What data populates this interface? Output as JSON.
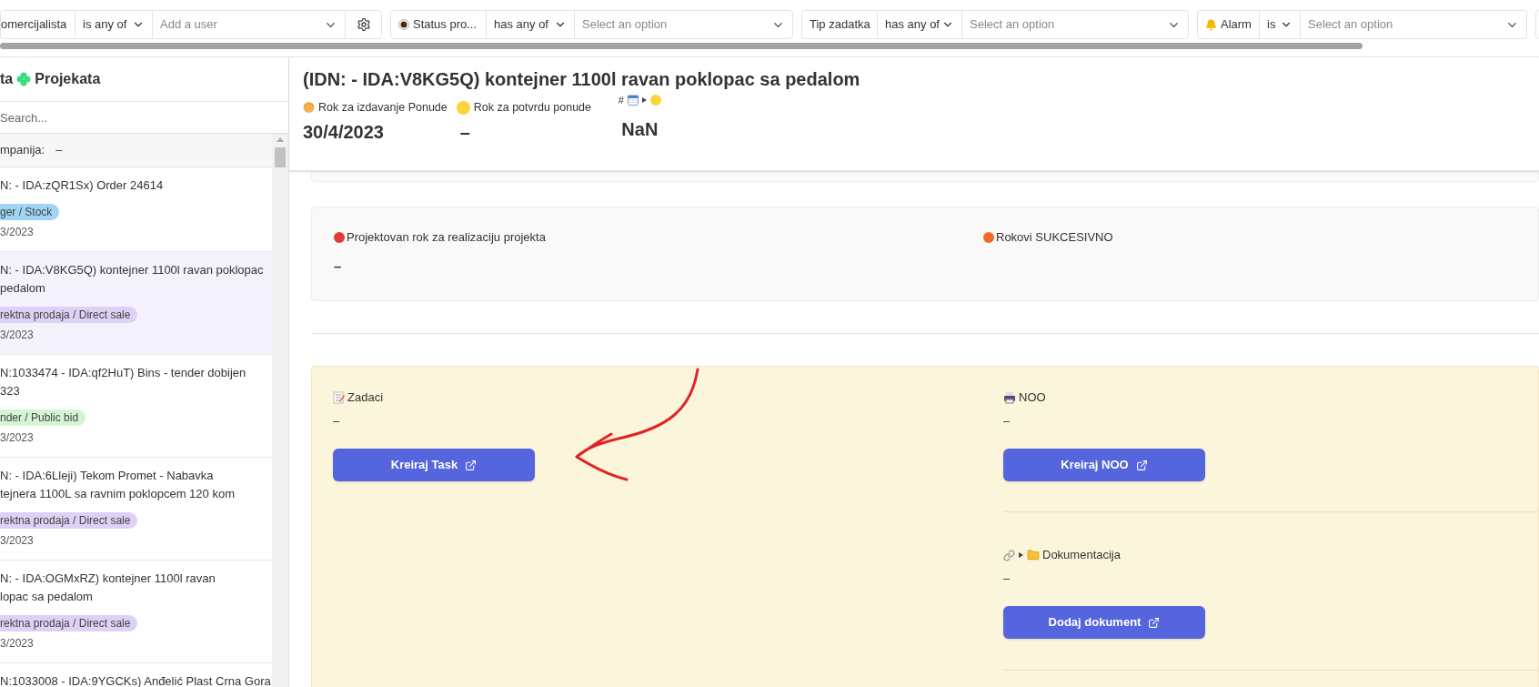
{
  "filters": [
    {
      "label": "omercijalista",
      "operator": "is any of",
      "placeholder": "Add a user",
      "settings": true
    },
    {
      "label": "Status pro...",
      "operator": "has any of",
      "placeholder": "Select an option",
      "settings": false
    },
    {
      "label": "Tip zadatka",
      "operator": "has any of",
      "placeholder": "Select an option",
      "settings": false
    },
    {
      "label": "Alarm",
      "operator": "is",
      "placeholder": "Select an option",
      "settings": false
    }
  ],
  "sidebar": {
    "title_start": "ta",
    "title": "Projekata",
    "search": {
      "placeholder": "Search..."
    },
    "group": {
      "label": "mpanija:",
      "value": "–"
    },
    "items": [
      {
        "lines": [
          "N: - IDA:zQR1Sx) Order 24614"
        ],
        "tag": "ger / Stock",
        "color": "#9fd4f5",
        "date": "3/2023",
        "selected": false
      },
      {
        "lines": [
          "N: - IDA:V8KG5Q) kontejner 1100l ravan poklopac",
          "pedalom"
        ],
        "tag": "rektna prodaja / Direct sale",
        "color": "#ddd2f6",
        "date": "3/2023",
        "selected": true
      },
      {
        "lines": [
          "N:1033474 - IDA:qf2HuT) Bins - tender dobijen",
          "323"
        ],
        "tag": "nder / Public bid",
        "color": "#d4f5d4",
        "date": "3/2023",
        "selected": false
      },
      {
        "lines": [
          "N: - IDA:6Lleji) Tekom Promet - Nabavka",
          "tejnera 1100L sa ravnim poklopcem 120 kom"
        ],
        "tag": "rektna prodaja / Direct sale",
        "color": "#ddd2f6",
        "date": "3/2023",
        "selected": false
      },
      {
        "lines": [
          "N: - IDA:OGMxRZ) kontejner 1100l ravan",
          "lopac sa pedalom"
        ],
        "tag": "rektna prodaja / Direct sale",
        "color": "#ddd2f6",
        "date": "3/2023",
        "selected": false
      },
      {
        "lines": [
          "N:1033008 - IDA:9YGCKs) Anđelić Plast Crna Gora"
        ],
        "selected": false
      }
    ]
  },
  "header": {
    "title": "(IDN: - IDA:V8KG5Q) kontejner 1100l ravan poklopac sa pedalom",
    "fields": [
      {
        "label": "Rok za izdavanje Ponude",
        "value": "30/4/2023"
      },
      {
        "label": "Rok za potvrdu ponude",
        "value": "–"
      },
      {
        "label": "#",
        "value": "NaN"
      }
    ]
  },
  "deadlines": [
    {
      "label": "Projektovan rok za realizaciju projekta",
      "color": "#e53935",
      "value": "–"
    },
    {
      "label": "Rokovi SUKCESIVNO",
      "color": "#f26b2a"
    }
  ],
  "panel": {
    "left": [
      {
        "label": "Zadaci",
        "value": "–",
        "button": "Kreiraj Task"
      }
    ],
    "right": [
      {
        "label": "NOO",
        "value": "–",
        "button": "Kreiraj NOO"
      },
      {
        "label": "Dokumentacija",
        "value": "–",
        "button": "Dodaj dokument"
      }
    ]
  }
}
